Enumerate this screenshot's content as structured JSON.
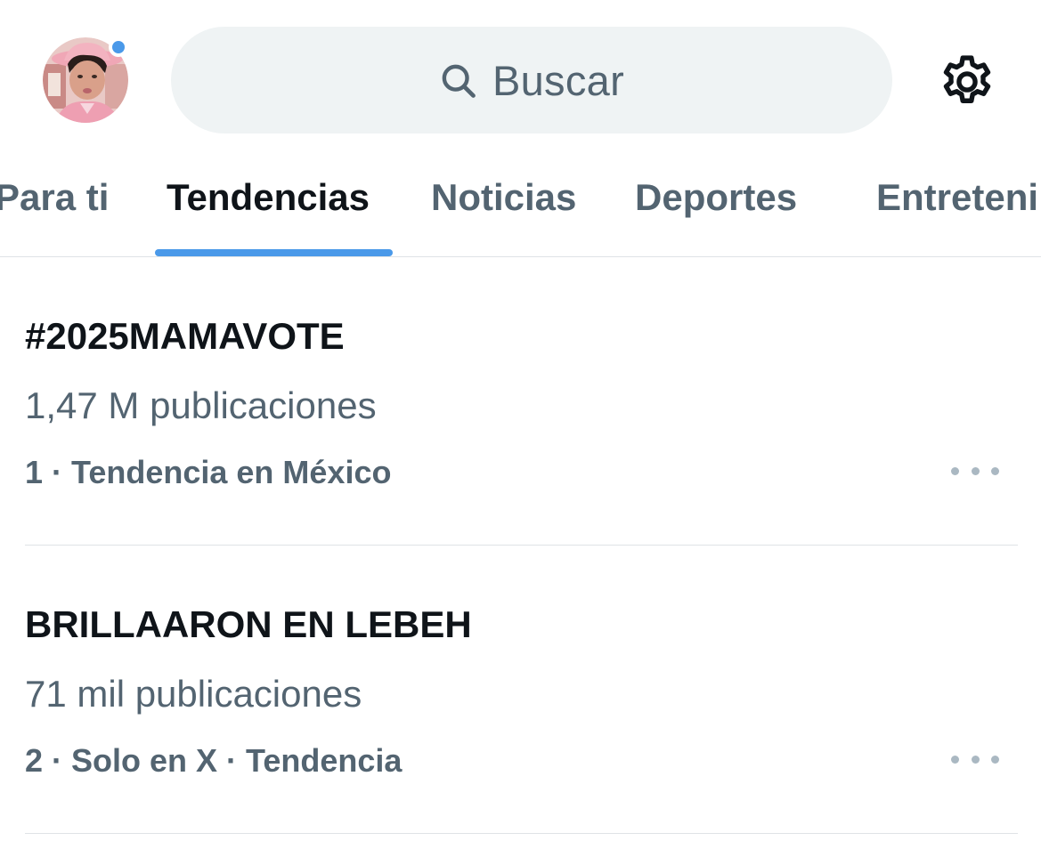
{
  "header": {
    "search_placeholder": "Buscar",
    "has_notification_dot": true
  },
  "tabs": [
    {
      "label": "Para ti",
      "active": false
    },
    {
      "label": "Tendencias",
      "active": true
    },
    {
      "label": "Noticias",
      "active": false
    },
    {
      "label": "Deportes",
      "active": false
    },
    {
      "label": "Entreteni",
      "active": false
    }
  ],
  "trends": [
    {
      "name": "#2025MAMAVOTE",
      "posts": "1,47 M publicaciones",
      "meta": "1 · Tendencia en México"
    },
    {
      "name": "BRILLAARON EN LEBEH",
      "posts": "71 mil publicaciones",
      "meta": "2 · Solo en X · Tendencia"
    }
  ],
  "icons": {
    "search": "search-icon",
    "settings": "gear-icon",
    "more": "more-horizontal-icon",
    "avatar": "user-avatar"
  },
  "colors": {
    "accent": "#4a99e9",
    "text_primary": "#0f1419",
    "text_secondary": "#536471",
    "search_bg": "#eff3f4",
    "divider": "#dfe3e6"
  }
}
